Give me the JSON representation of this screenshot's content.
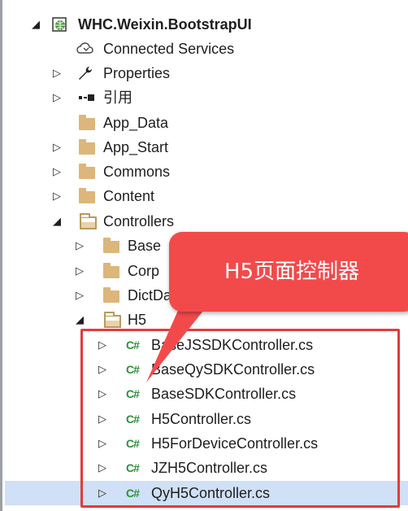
{
  "tree": {
    "project": {
      "label": "WHC.Weixin.BootstrapUI",
      "icon": "web-project-icon",
      "expanded": true
    },
    "items": [
      {
        "label": "Connected Services",
        "icon": "cloud-service-icon"
      },
      {
        "label": "Properties",
        "icon": "wrench-icon"
      },
      {
        "label": "引用",
        "icon": "reference-icon"
      },
      {
        "label": "App_Data",
        "icon": "folder-icon"
      },
      {
        "label": "App_Start",
        "icon": "folder-icon"
      },
      {
        "label": "Commons",
        "icon": "folder-icon"
      },
      {
        "label": "Content",
        "icon": "folder-icon"
      },
      {
        "label": "Controllers",
        "icon": "open-folder-icon",
        "expanded": true
      },
      {
        "label": "Base",
        "icon": "folder-icon"
      },
      {
        "label": "Corp",
        "icon": "folder-icon"
      },
      {
        "label": "DictData",
        "icon": "folder-icon"
      },
      {
        "label": "H5",
        "icon": "open-folder-icon",
        "expanded": true
      },
      {
        "label": "BaseJSSDKController.cs",
        "icon": "csharp-file-icon"
      },
      {
        "label": "BaseQySDKController.cs",
        "icon": "csharp-file-icon"
      },
      {
        "label": "BaseSDKController.cs",
        "icon": "csharp-file-icon"
      },
      {
        "label": "H5Controller.cs",
        "icon": "csharp-file-icon"
      },
      {
        "label": "H5ForDeviceController.cs",
        "icon": "csharp-file-icon"
      },
      {
        "label": "JZH5Controller.cs",
        "icon": "csharp-file-icon"
      },
      {
        "label": "QyH5Controller.cs",
        "icon": "csharp-file-icon",
        "selected": true
      }
    ],
    "cs_glyph": "C#"
  },
  "annotation": {
    "callout_text": "H5页面控制器",
    "callout_color": "#f24a4b",
    "box_color": "#e23b3b"
  },
  "colors": {
    "selection": "#cfe0f7",
    "folder": "#dcb67a",
    "csharp": "#2f8f3a"
  }
}
